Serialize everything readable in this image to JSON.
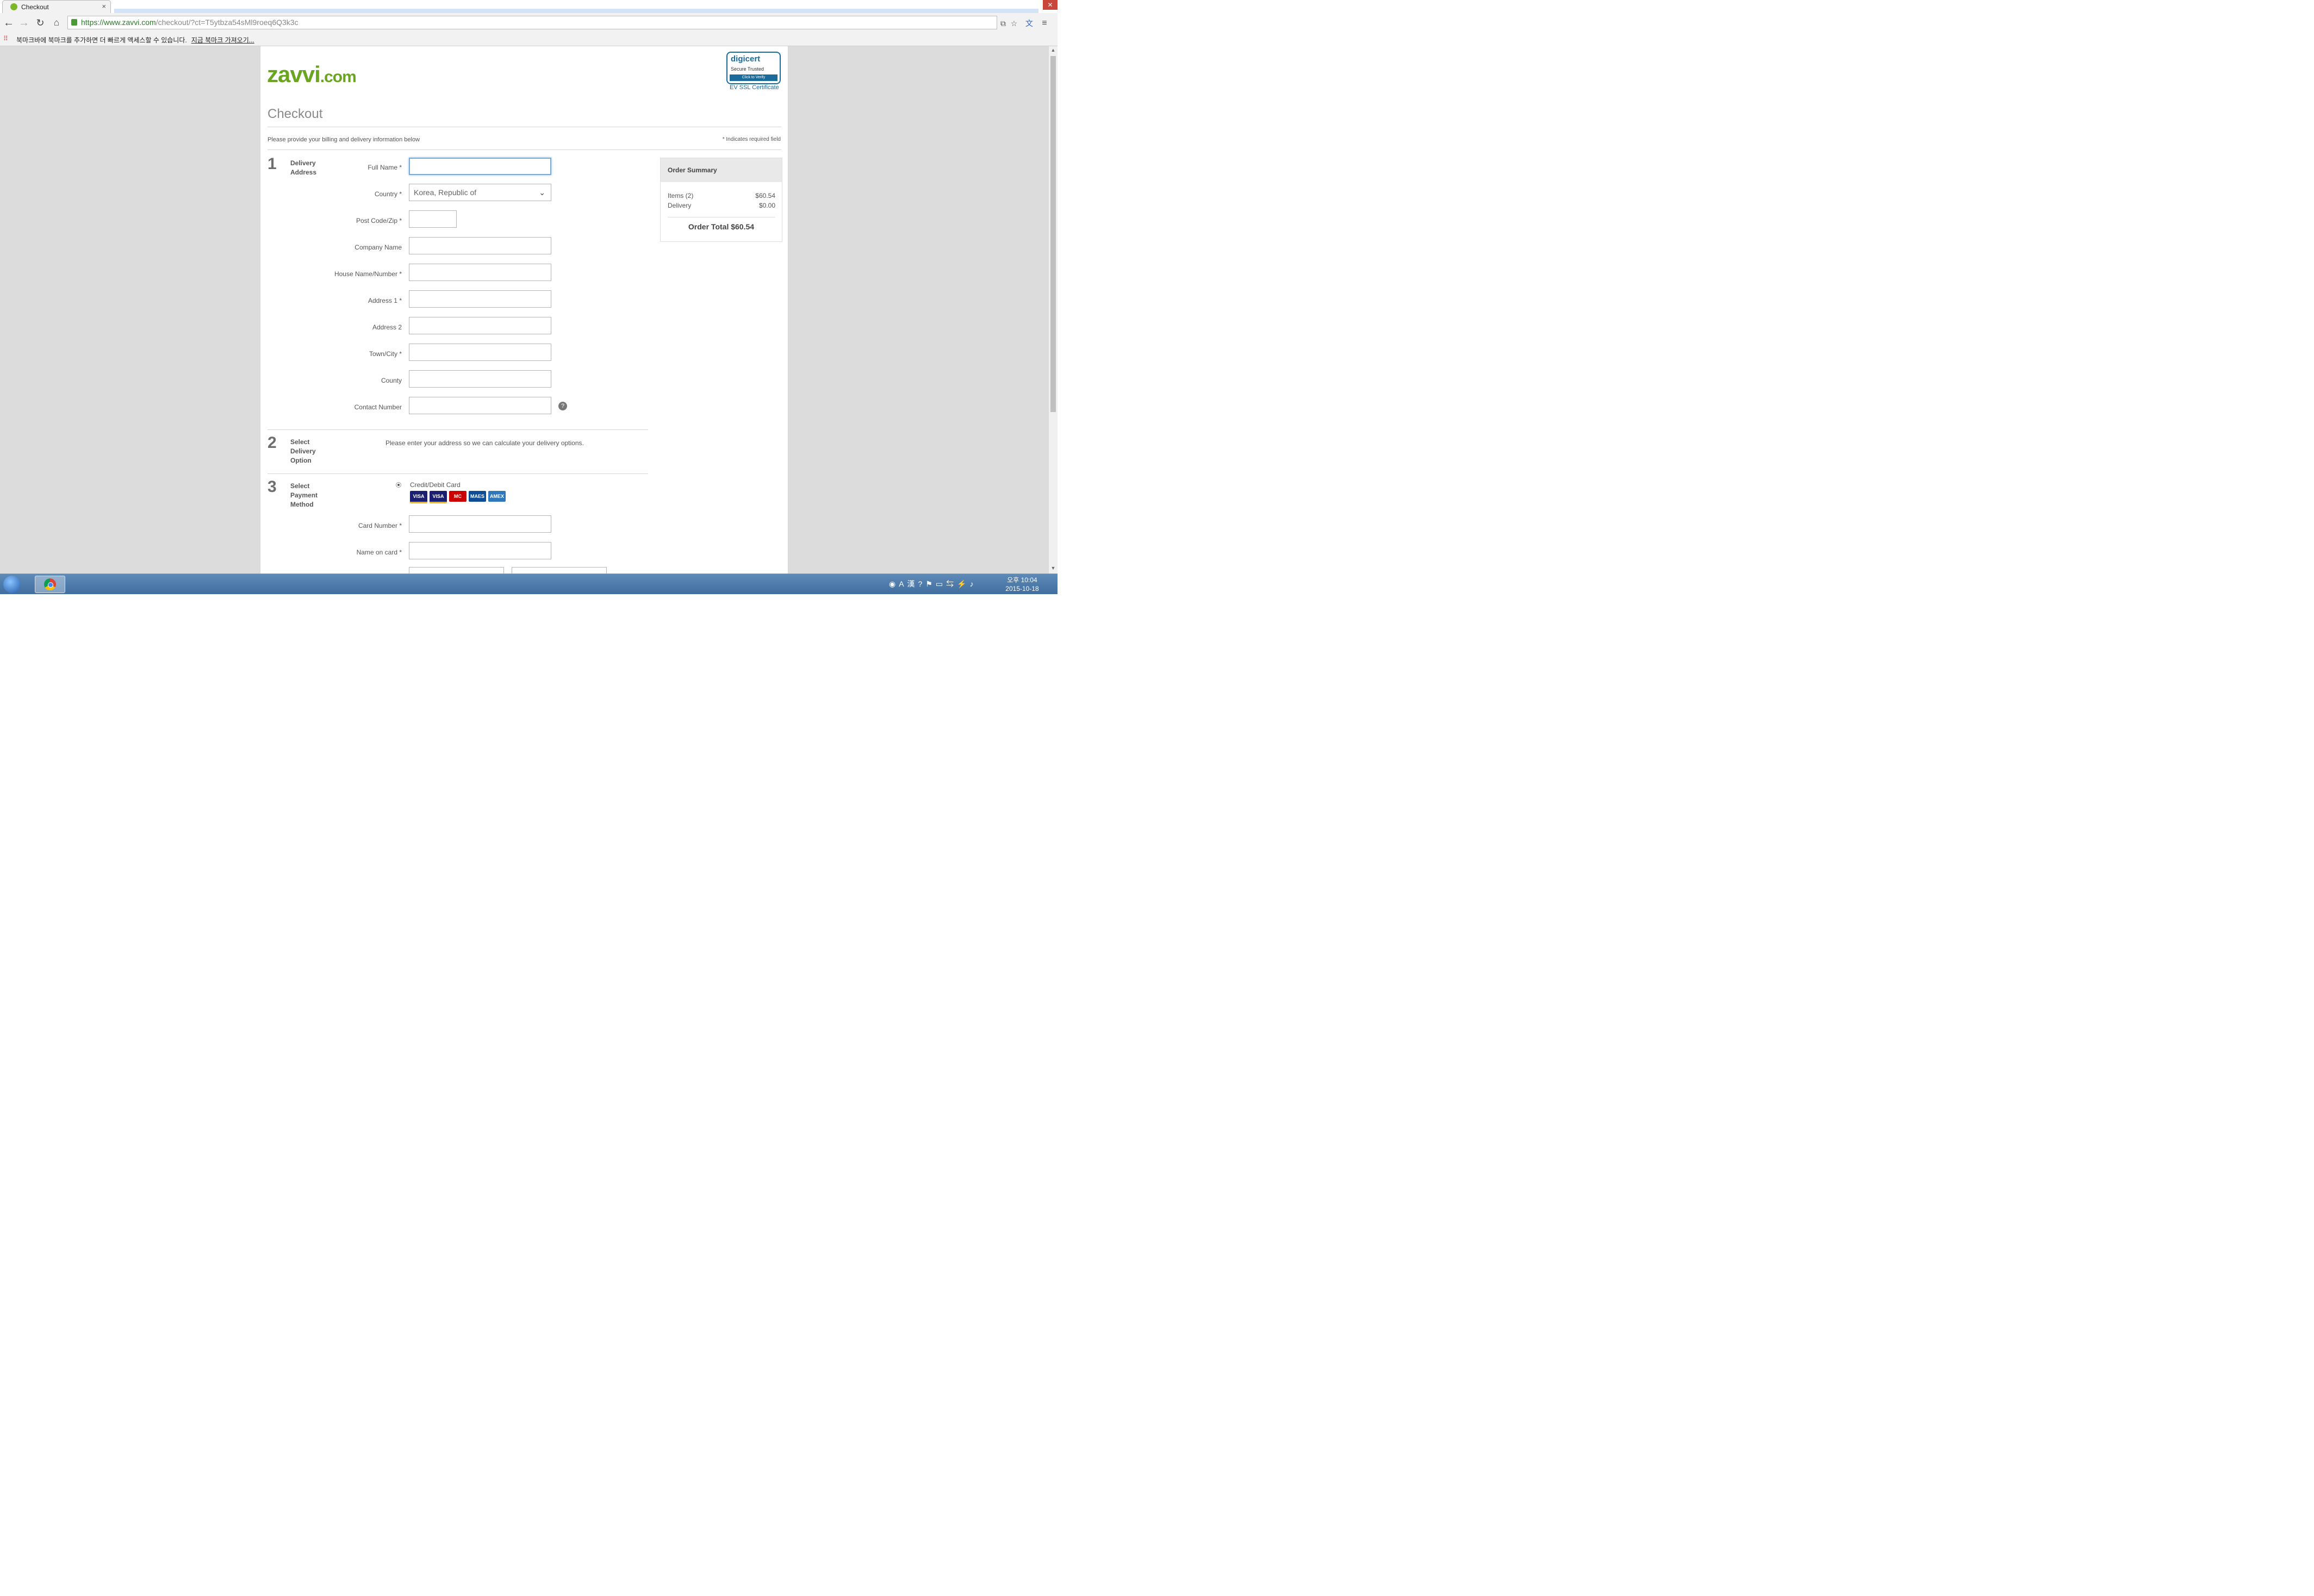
{
  "browser": {
    "tab_title": "Checkout",
    "url_host": "https://www.zavvi.com",
    "url_path": "/checkout/?ct=T5ytbza54sMl9roeq6Q3k3c",
    "bookmarks_message": "북마크바에 북마크를 추가하면 더 빠르게 액세스할 수 있습니다.",
    "bookmarks_link": "지금 북마크 가져오기..."
  },
  "page": {
    "logo_main": "zavvi",
    "logo_sub": ".com",
    "digicert_brand": "digicert",
    "digicert_tagline": "Secure Trusted",
    "digicert_bar": "Click to Verify",
    "digicert_caption": "EV SSL Certificate",
    "title": "Checkout",
    "intro": "Please provide your billing and delivery information below",
    "required_note": "* Indicates required field"
  },
  "steps": [
    {
      "num": "1",
      "label": "Delivery Address"
    },
    {
      "num": "2",
      "label": "Select Delivery Option"
    },
    {
      "num": "3",
      "label": "Select Payment Method"
    }
  ],
  "address_form": {
    "full_name_label": "Full Name *",
    "country_label": "Country *",
    "country_value": "Korea, Republic of",
    "postcode_label": "Post Code/Zip *",
    "company_label": "Company Name",
    "house_label": "House Name/Number *",
    "address1_label": "Address 1 *",
    "address2_label": "Address 2",
    "town_label": "Town/City *",
    "county_label": "County",
    "contact_label": "Contact Number"
  },
  "delivery": {
    "message": "Please enter your address so we can calculate your delivery options."
  },
  "payment": {
    "method_label": "Credit/Debit Card",
    "card_logos": [
      "VISA",
      "VISA",
      "MC",
      "MAES",
      "AMEX"
    ],
    "card_number_label": "Card Number *",
    "name_on_card_label": "Name on card *"
  },
  "summary": {
    "title": "Order Summary",
    "items_label": "Items (2)",
    "items_value": "$60.54",
    "delivery_label": "Delivery",
    "delivery_value": "$0.00",
    "total": "Order Total $60.54"
  },
  "taskbar": {
    "clock_time": "오후 10:04",
    "clock_date": "2015-10-18"
  },
  "colors": {
    "brand_green": "#6aa421",
    "digicert_blue": "#1b6b9a"
  }
}
